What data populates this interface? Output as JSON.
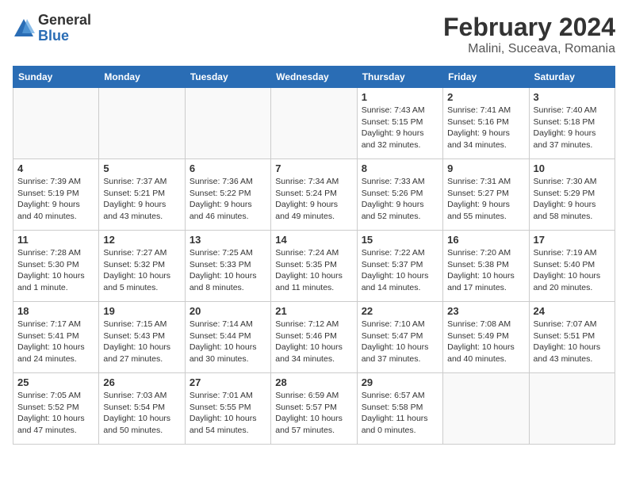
{
  "logo": {
    "general": "General",
    "blue": "Blue"
  },
  "title": {
    "month_year": "February 2024",
    "location": "Malini, Suceava, Romania"
  },
  "weekdays": [
    "Sunday",
    "Monday",
    "Tuesday",
    "Wednesday",
    "Thursday",
    "Friday",
    "Saturday"
  ],
  "weeks": [
    [
      {
        "day": "",
        "info": ""
      },
      {
        "day": "",
        "info": ""
      },
      {
        "day": "",
        "info": ""
      },
      {
        "day": "",
        "info": ""
      },
      {
        "day": "1",
        "info": "Sunrise: 7:43 AM\nSunset: 5:15 PM\nDaylight: 9 hours\nand 32 minutes."
      },
      {
        "day": "2",
        "info": "Sunrise: 7:41 AM\nSunset: 5:16 PM\nDaylight: 9 hours\nand 34 minutes."
      },
      {
        "day": "3",
        "info": "Sunrise: 7:40 AM\nSunset: 5:18 PM\nDaylight: 9 hours\nand 37 minutes."
      }
    ],
    [
      {
        "day": "4",
        "info": "Sunrise: 7:39 AM\nSunset: 5:19 PM\nDaylight: 9 hours\nand 40 minutes."
      },
      {
        "day": "5",
        "info": "Sunrise: 7:37 AM\nSunset: 5:21 PM\nDaylight: 9 hours\nand 43 minutes."
      },
      {
        "day": "6",
        "info": "Sunrise: 7:36 AM\nSunset: 5:22 PM\nDaylight: 9 hours\nand 46 minutes."
      },
      {
        "day": "7",
        "info": "Sunrise: 7:34 AM\nSunset: 5:24 PM\nDaylight: 9 hours\nand 49 minutes."
      },
      {
        "day": "8",
        "info": "Sunrise: 7:33 AM\nSunset: 5:26 PM\nDaylight: 9 hours\nand 52 minutes."
      },
      {
        "day": "9",
        "info": "Sunrise: 7:31 AM\nSunset: 5:27 PM\nDaylight: 9 hours\nand 55 minutes."
      },
      {
        "day": "10",
        "info": "Sunrise: 7:30 AM\nSunset: 5:29 PM\nDaylight: 9 hours\nand 58 minutes."
      }
    ],
    [
      {
        "day": "11",
        "info": "Sunrise: 7:28 AM\nSunset: 5:30 PM\nDaylight: 10 hours\nand 1 minute."
      },
      {
        "day": "12",
        "info": "Sunrise: 7:27 AM\nSunset: 5:32 PM\nDaylight: 10 hours\nand 5 minutes."
      },
      {
        "day": "13",
        "info": "Sunrise: 7:25 AM\nSunset: 5:33 PM\nDaylight: 10 hours\nand 8 minutes."
      },
      {
        "day": "14",
        "info": "Sunrise: 7:24 AM\nSunset: 5:35 PM\nDaylight: 10 hours\nand 11 minutes."
      },
      {
        "day": "15",
        "info": "Sunrise: 7:22 AM\nSunset: 5:37 PM\nDaylight: 10 hours\nand 14 minutes."
      },
      {
        "day": "16",
        "info": "Sunrise: 7:20 AM\nSunset: 5:38 PM\nDaylight: 10 hours\nand 17 minutes."
      },
      {
        "day": "17",
        "info": "Sunrise: 7:19 AM\nSunset: 5:40 PM\nDaylight: 10 hours\nand 20 minutes."
      }
    ],
    [
      {
        "day": "18",
        "info": "Sunrise: 7:17 AM\nSunset: 5:41 PM\nDaylight: 10 hours\nand 24 minutes."
      },
      {
        "day": "19",
        "info": "Sunrise: 7:15 AM\nSunset: 5:43 PM\nDaylight: 10 hours\nand 27 minutes."
      },
      {
        "day": "20",
        "info": "Sunrise: 7:14 AM\nSunset: 5:44 PM\nDaylight: 10 hours\nand 30 minutes."
      },
      {
        "day": "21",
        "info": "Sunrise: 7:12 AM\nSunset: 5:46 PM\nDaylight: 10 hours\nand 34 minutes."
      },
      {
        "day": "22",
        "info": "Sunrise: 7:10 AM\nSunset: 5:47 PM\nDaylight: 10 hours\nand 37 minutes."
      },
      {
        "day": "23",
        "info": "Sunrise: 7:08 AM\nSunset: 5:49 PM\nDaylight: 10 hours\nand 40 minutes."
      },
      {
        "day": "24",
        "info": "Sunrise: 7:07 AM\nSunset: 5:51 PM\nDaylight: 10 hours\nand 43 minutes."
      }
    ],
    [
      {
        "day": "25",
        "info": "Sunrise: 7:05 AM\nSunset: 5:52 PM\nDaylight: 10 hours\nand 47 minutes."
      },
      {
        "day": "26",
        "info": "Sunrise: 7:03 AM\nSunset: 5:54 PM\nDaylight: 10 hours\nand 50 minutes."
      },
      {
        "day": "27",
        "info": "Sunrise: 7:01 AM\nSunset: 5:55 PM\nDaylight: 10 hours\nand 54 minutes."
      },
      {
        "day": "28",
        "info": "Sunrise: 6:59 AM\nSunset: 5:57 PM\nDaylight: 10 hours\nand 57 minutes."
      },
      {
        "day": "29",
        "info": "Sunrise: 6:57 AM\nSunset: 5:58 PM\nDaylight: 11 hours\nand 0 minutes."
      },
      {
        "day": "",
        "info": ""
      },
      {
        "day": "",
        "info": ""
      }
    ]
  ]
}
